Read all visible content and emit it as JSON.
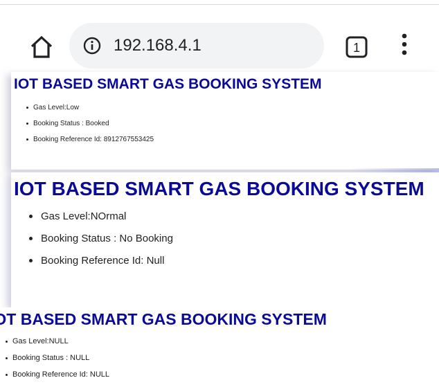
{
  "browser": {
    "url": "192.168.4.1",
    "tab_count": "1",
    "icons": [
      "home-icon",
      "info-icon",
      "tab-switcher-icon",
      "more-menu-icon"
    ]
  },
  "panels": [
    {
      "title": "IOT BASED SMART GAS BOOKING SYSTEM",
      "items": [
        "Gas Level:Low",
        "Booking Status : Booked",
        "Booking Reference Id: 8912767553425"
      ]
    },
    {
      "title": "IOT BASED SMART GAS BOOKING SYSTEM",
      "items": [
        "Gas Level:NOrmal",
        "Booking Status : No Booking",
        "Booking Reference Id: Null"
      ]
    },
    {
      "title": "IOT BASED SMART GAS BOOKING SYSTEM",
      "items": [
        "Gas Level:NULL",
        "Booking Status : NULL",
        "Booking Reference Id: NULL"
      ]
    }
  ],
  "colors": {
    "title": "#0a0a96",
    "text": "#222222",
    "url_bg": "#f1f3f4"
  }
}
